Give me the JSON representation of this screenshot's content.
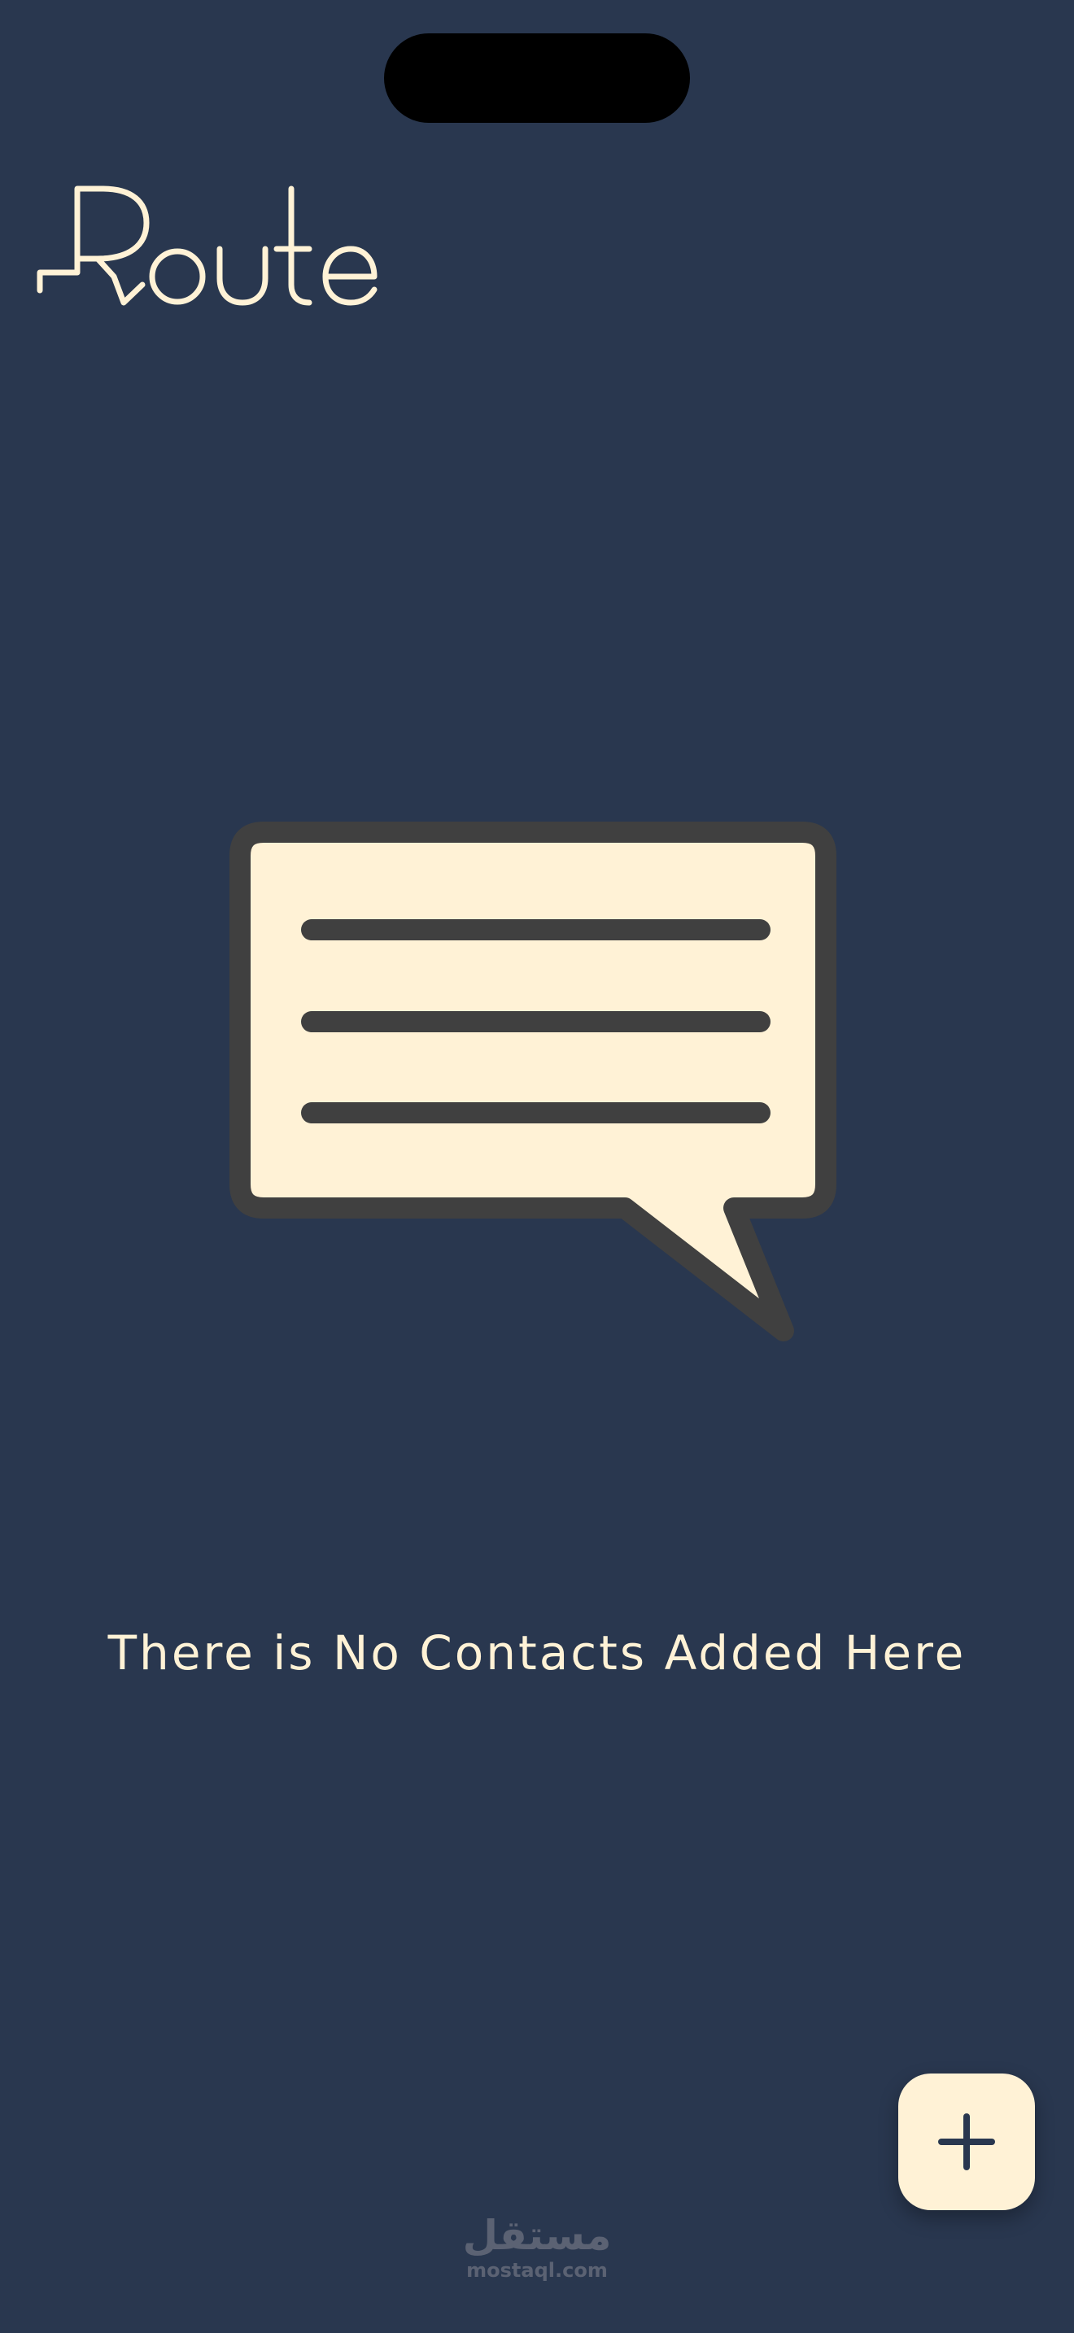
{
  "app": {
    "name": "Route",
    "background_color": "#29374F",
    "accent_color": "#FFF2D6"
  },
  "logo": {
    "text": "Route",
    "icon": "route-logo"
  },
  "empty_state": {
    "icon": "chat-bubble-icon",
    "message": "There is No Contacts Added Here"
  },
  "fab": {
    "icon": "plus-icon",
    "action": "add-contact"
  },
  "watermark": {
    "arabic_text": "مستقل",
    "domain_text": "mostaql.com"
  }
}
